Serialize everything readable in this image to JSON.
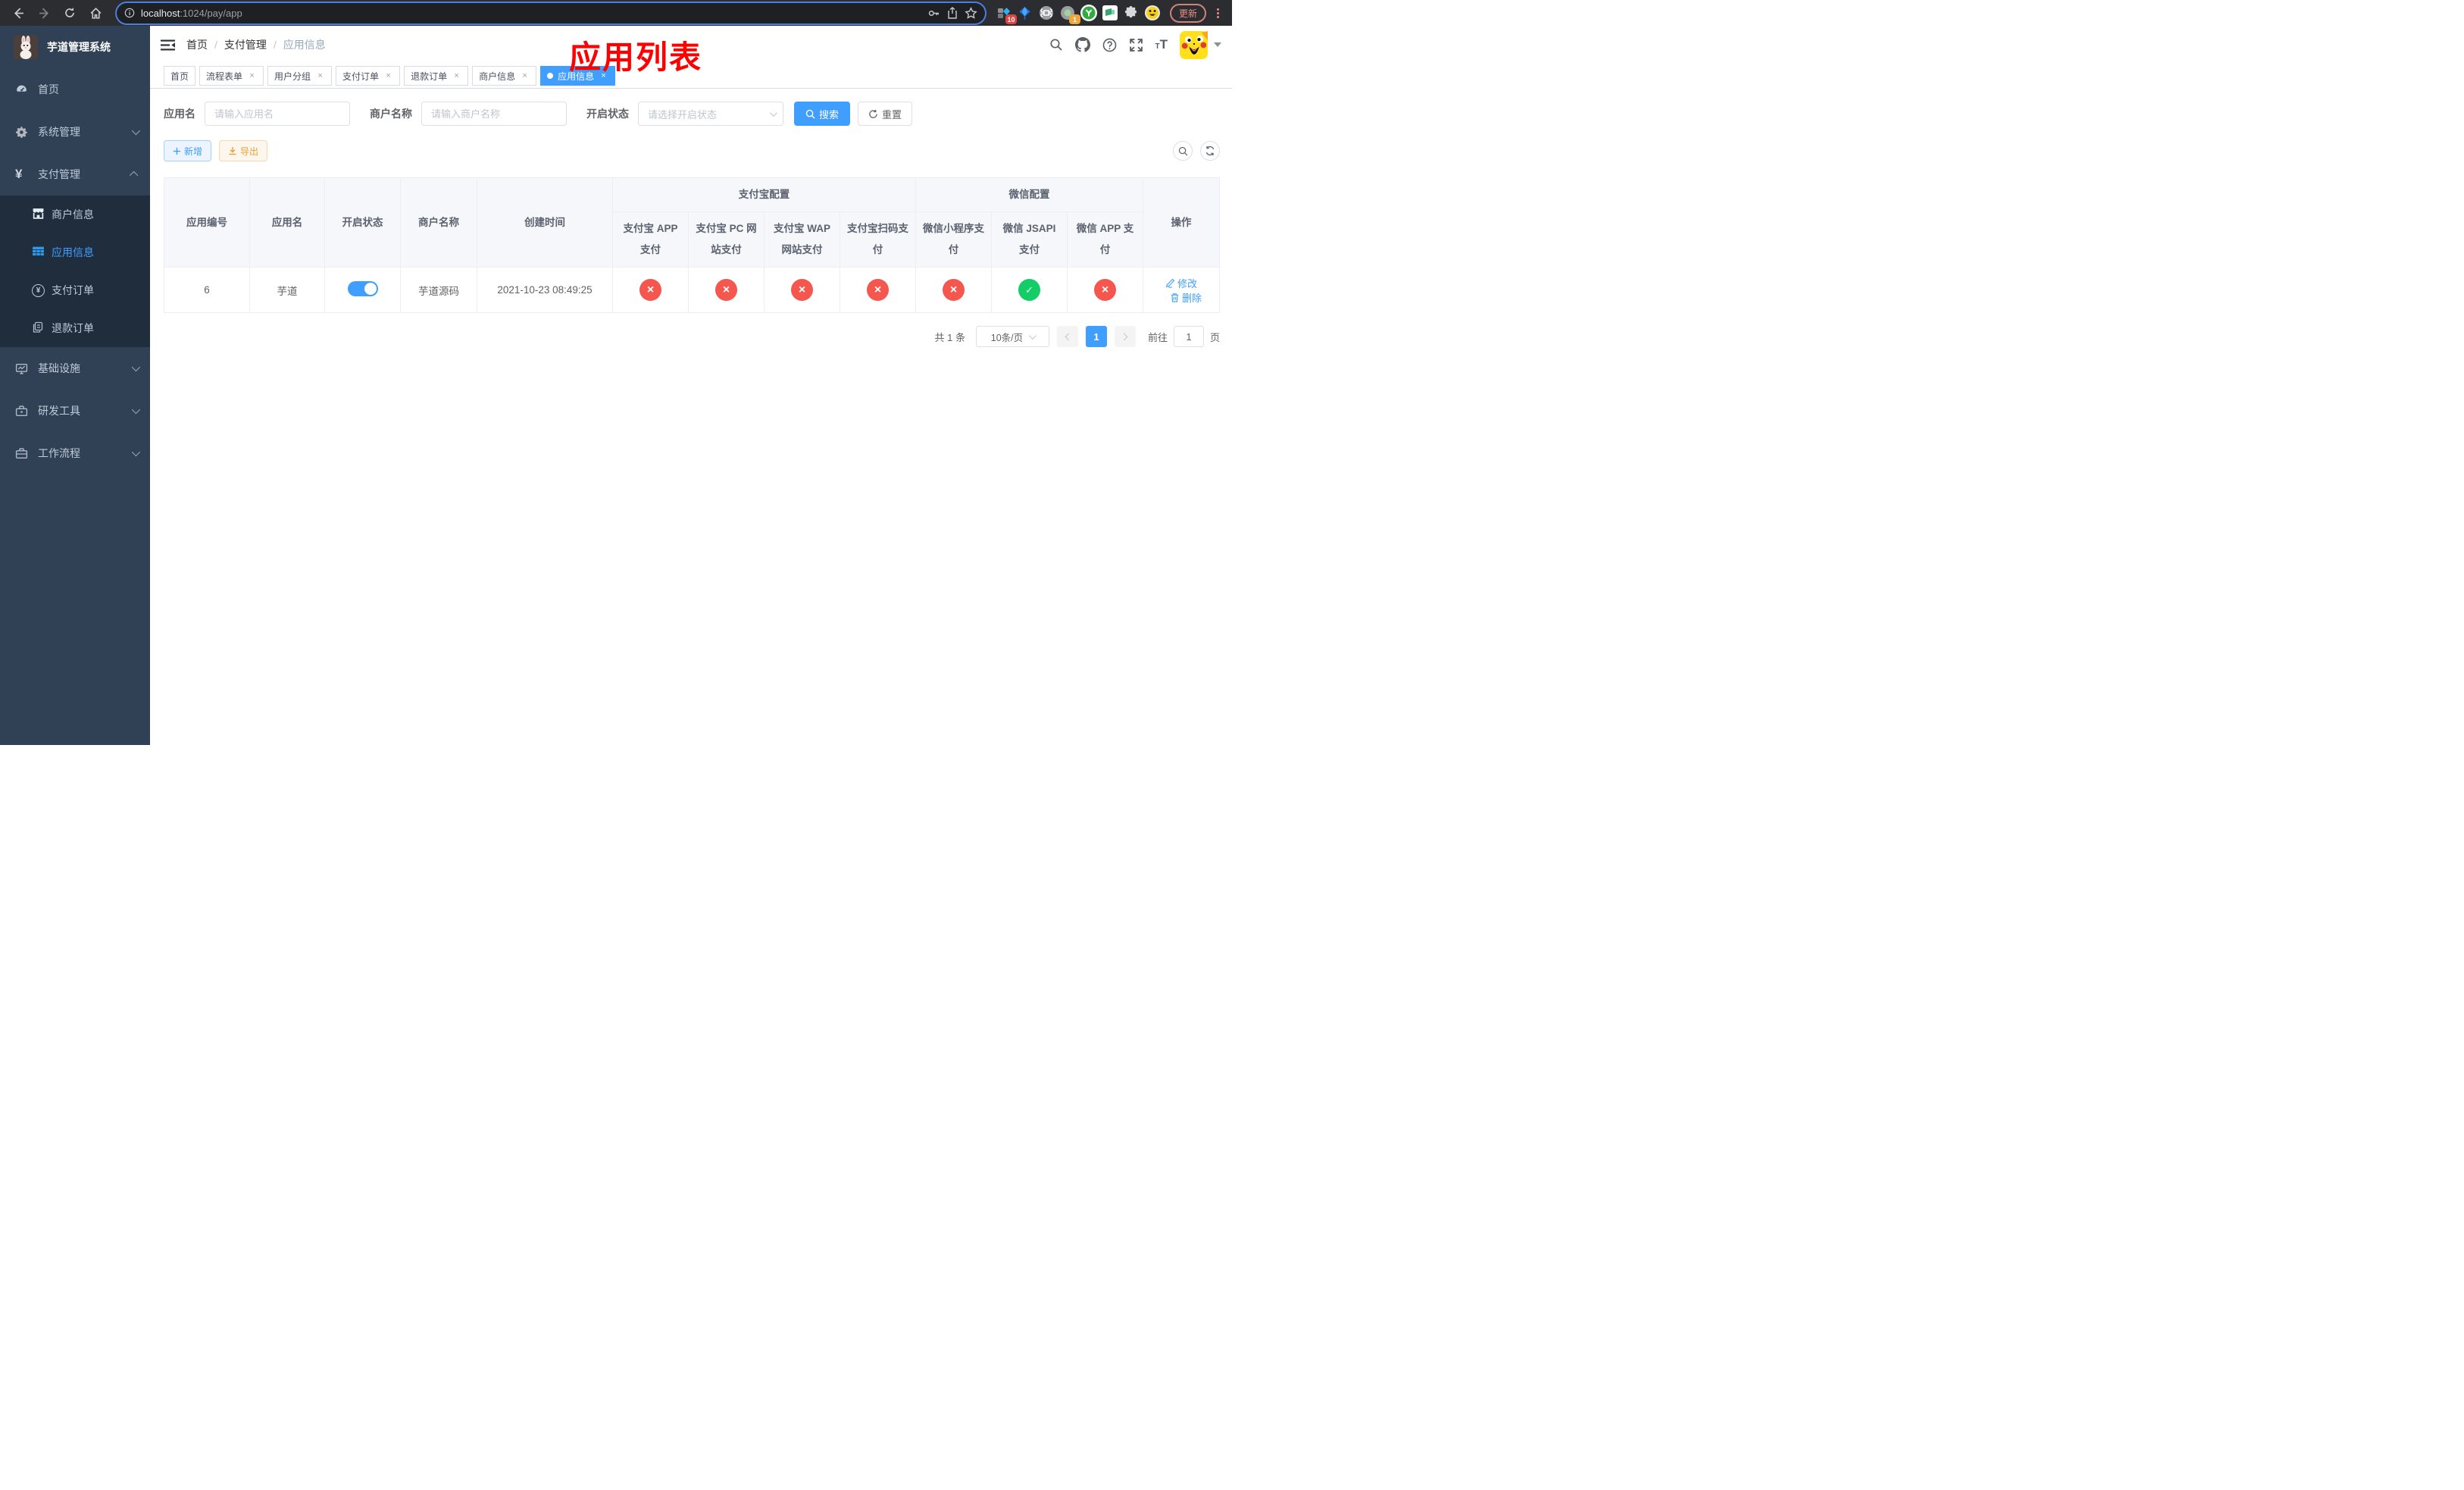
{
  "colors": {
    "accent": "#409eff",
    "success": "#13ce66",
    "danger": "#f5564e",
    "warning": "#e6a23c",
    "sidebar_bg": "#304156",
    "submenu_bg": "#1f2d3d",
    "annotation_red": "#fd0100"
  },
  "browser": {
    "url_host": "localhost",
    "url_path": ":1024/pay/app",
    "ext_badge_blocks": "10",
    "ext_badge_camera": "1",
    "ext_letter_y": "y",
    "update_label": "更新"
  },
  "sidebar": {
    "title": "芋道管理系统",
    "items": [
      {
        "label": "首页"
      },
      {
        "label": "系统管理"
      },
      {
        "label": "支付管理"
      },
      {
        "label": "基础设施"
      },
      {
        "label": "研发工具"
      },
      {
        "label": "工作流程"
      }
    ],
    "payment_children": [
      {
        "label": "商户信息"
      },
      {
        "label": "应用信息"
      },
      {
        "label": "支付订单"
      },
      {
        "label": "退款订单"
      }
    ]
  },
  "breadcrumb": {
    "items": [
      "首页",
      "支付管理",
      "应用信息"
    ]
  },
  "annotation": {
    "text": "应用列表"
  },
  "tabs": [
    {
      "label": "首页"
    },
    {
      "label": "流程表单"
    },
    {
      "label": "用户分组"
    },
    {
      "label": "支付订单"
    },
    {
      "label": "退款订单"
    },
    {
      "label": "商户信息"
    },
    {
      "label": "应用信息"
    }
  ],
  "filters": {
    "app_name_label": "应用名",
    "app_name_placeholder": "请输入应用名",
    "merchant_label": "商户名称",
    "merchant_placeholder": "请输入商户名称",
    "status_label": "开启状态",
    "status_placeholder": "请选择开启状态",
    "search_label": "搜索",
    "reset_label": "重置"
  },
  "toolbar": {
    "add_label": "新增",
    "export_label": "导出"
  },
  "table": {
    "headers": {
      "id": "应用编号",
      "name": "应用名",
      "status": "开启状态",
      "merchant": "商户名称",
      "created": "创建时间",
      "alipay_group": "支付宝配置",
      "wechat_group": "微信配置",
      "alipay_app": "支付宝 APP 支付",
      "alipay_pc": "支付宝 PC 网站支付",
      "alipay_wap": "支付宝 WAP 网站支付",
      "alipay_qr": "支付宝扫码支付",
      "wx_lite": "微信小程序支付",
      "wx_jsapi": "微信 JSAPI 支付",
      "wx_app": "微信 APP 支付",
      "actions": "操作"
    },
    "row": {
      "id": "6",
      "name": "芋道",
      "enabled": "true",
      "merchant": "芋道源码",
      "created": "2021-10-23 08:49:25",
      "statuses": [
        "error",
        "error",
        "error",
        "error",
        "error",
        "success",
        "error"
      ],
      "edit_label": "修改",
      "delete_label": "删除"
    }
  },
  "pagination": {
    "total": "共 1 条",
    "page_size": "10条/页",
    "page": "1",
    "goto_label": "前往",
    "goto_value": "1",
    "unit_label": "页"
  },
  "icons": {
    "check_glyph": "✓",
    "cross_glyph": "×"
  }
}
